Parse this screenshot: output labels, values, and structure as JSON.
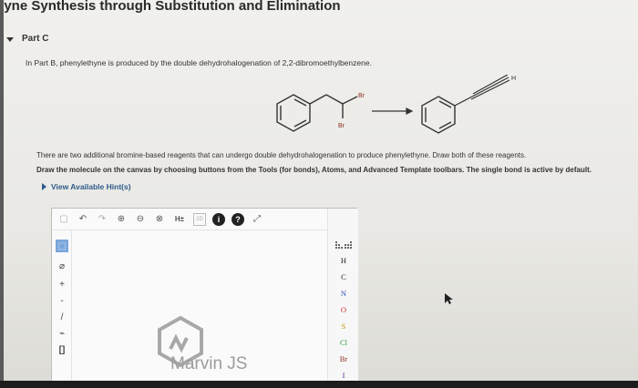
{
  "page": {
    "title": "kyne Synthesis through Substitution and Elimination",
    "part_label": "Part C"
  },
  "problem": {
    "intro": "In Part B, phenylethyne is produced by the double dehydrohalogenation of 2,2-dibromoethylbenzene.",
    "reaction_labels": {
      "br_top": "Br",
      "br_bottom": "Br",
      "h_label": "H"
    },
    "question": "There are two additional bromine-based reagents that can undergo double dehydrohalogenation to produce phenylethyne. Draw both of these reagents.",
    "instructions": "Draw the molecule on the canvas by choosing buttons from the Tools (for bonds), Atoms, and Advanced Template toolbars. The single bond is active by default.",
    "hints_link": "View Available Hint(s)"
  },
  "editor": {
    "watermark_text": "Marvin JS",
    "top_toolbar": [
      {
        "name": "new-doc-icon",
        "glyph": "▢",
        "muted": true
      },
      {
        "name": "undo-icon",
        "glyph": "↶",
        "muted": false
      },
      {
        "name": "redo-icon",
        "glyph": "↷",
        "muted": true
      },
      {
        "name": "zoom-in-icon",
        "glyph": "⊕",
        "muted": false
      },
      {
        "name": "zoom-out-icon",
        "glyph": "⊖",
        "muted": false
      },
      {
        "name": "zoom-fit-icon",
        "glyph": "⊗",
        "muted": false
      },
      {
        "name": "hydrogens-icon",
        "glyph": "H±",
        "muted": false
      },
      {
        "name": "template-2d-icon",
        "glyph": "2D",
        "muted": true
      },
      {
        "name": "info-icon",
        "glyph": "i",
        "dark": true
      },
      {
        "name": "help-icon",
        "glyph": "?",
        "dark": true
      },
      {
        "name": "expand-icon",
        "glyph": "⤢",
        "muted": false
      }
    ],
    "left_toolbar": [
      {
        "name": "select-tool-icon",
        "glyph": "⬚",
        "selected": true
      },
      {
        "name": "erase-tool-icon",
        "glyph": "⌀"
      },
      {
        "name": "charge-plus-icon",
        "glyph": "+"
      },
      {
        "name": "charge-minus-icon",
        "glyph": "-"
      },
      {
        "name": "single-bond-icon",
        "glyph": "/"
      },
      {
        "name": "chain-tool-icon",
        "glyph": "⌁"
      },
      {
        "name": "bracket-tool-icon",
        "glyph": "[]"
      }
    ],
    "atoms": [
      "H",
      "C",
      "N",
      "O",
      "S",
      "Cl",
      "Br",
      "I"
    ],
    "atom_colors": {
      "H": "#222222",
      "C": "#222222",
      "N": "#2f4fbf",
      "O": "#d22d2d",
      "S": "#b8960f",
      "Cl": "#2f9a3a",
      "Br": "#8a2a1f",
      "I": "#6a2aa0"
    }
  }
}
